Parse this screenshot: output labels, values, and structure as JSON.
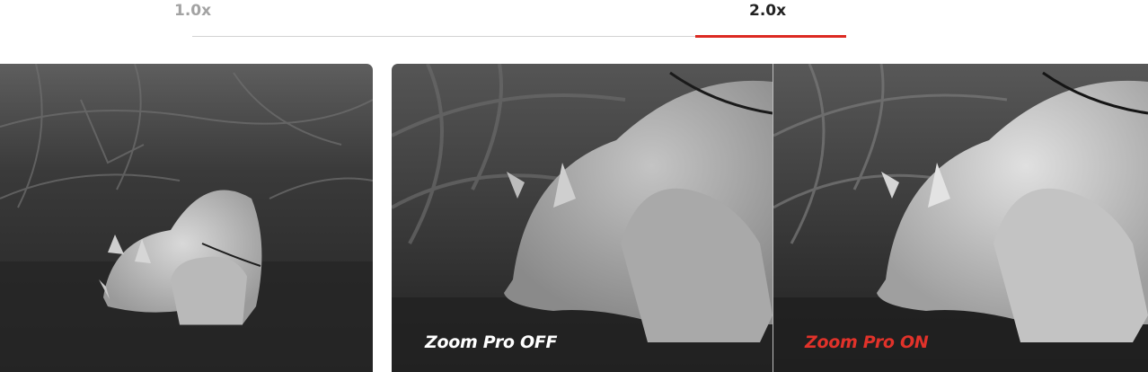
{
  "zoom_tabs": [
    {
      "label": "1.0x",
      "active": false
    },
    {
      "label": "2.0x",
      "active": true
    }
  ],
  "comparison": {
    "off_label": "Zoom Pro OFF",
    "on_label": "Zoom Pro ON"
  },
  "colors": {
    "accent": "#dc2a22",
    "active_tab_text": "#222222",
    "inactive_tab_text": "#a3a3a3",
    "on_label": "#e1322a",
    "off_label": "#ffffff"
  }
}
